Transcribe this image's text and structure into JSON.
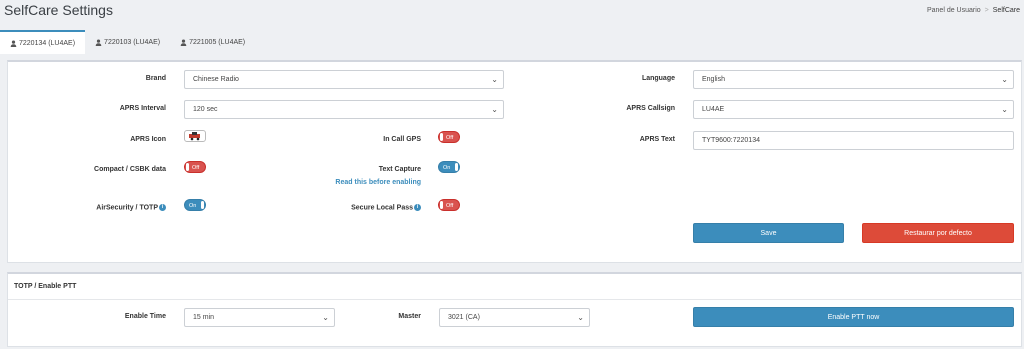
{
  "header": {
    "title": "SelfCare Settings",
    "breadcrumb": [
      "Panel de Usuario",
      "SelfCare"
    ]
  },
  "tabs": [
    {
      "label": "7220134 (LU4AE)",
      "active": true
    },
    {
      "label": "7220103 (LU4AE)",
      "active": false
    },
    {
      "label": "7221005 (LU4AE)",
      "active": false
    }
  ],
  "settings": {
    "brand_label": "Brand",
    "brand_value": "Chinese Radio",
    "language_label": "Language",
    "language_value": "English",
    "aprs_interval_label": "APRS Interval",
    "aprs_interval_value": "120 sec",
    "aprs_callsign_label": "APRS Callsign",
    "aprs_callsign_value": "LU4AE",
    "aprs_icon_label": "APRS Icon",
    "in_call_gps_label": "In Call GPS",
    "in_call_gps_state": "Off",
    "aprs_text_label": "APRS Text",
    "aprs_text_value": "TYT9600:7220134",
    "compact_label": "Compact / CSBK data",
    "compact_state": "Off",
    "text_capture_label": "Text Capture",
    "text_capture_state": "On",
    "read_this_link": "Read this before enabling",
    "air_security_label": "AirSecurity / TOTP",
    "air_security_state": "On",
    "secure_local_pass_label": "Secure Local Pass",
    "secure_local_pass_state": "Off",
    "save_label": "Save",
    "reset_label": "Restaurar por defecto"
  },
  "totp": {
    "title": "TOTP / Enable PTT",
    "enable_time_label": "Enable Time",
    "enable_time_value": "15 min",
    "master_label": "Master",
    "master_value": "3021 (CA)",
    "enable_ptt_label": "Enable PTT now"
  },
  "colors": {
    "primary": "#3c8dbc",
    "danger": "#dd4b39",
    "toggle_off": "#d9534f"
  },
  "icons": {
    "user": "user-icon",
    "info": "info-icon",
    "chevron": "chevron-down-icon",
    "vehicle": "car-icon"
  }
}
